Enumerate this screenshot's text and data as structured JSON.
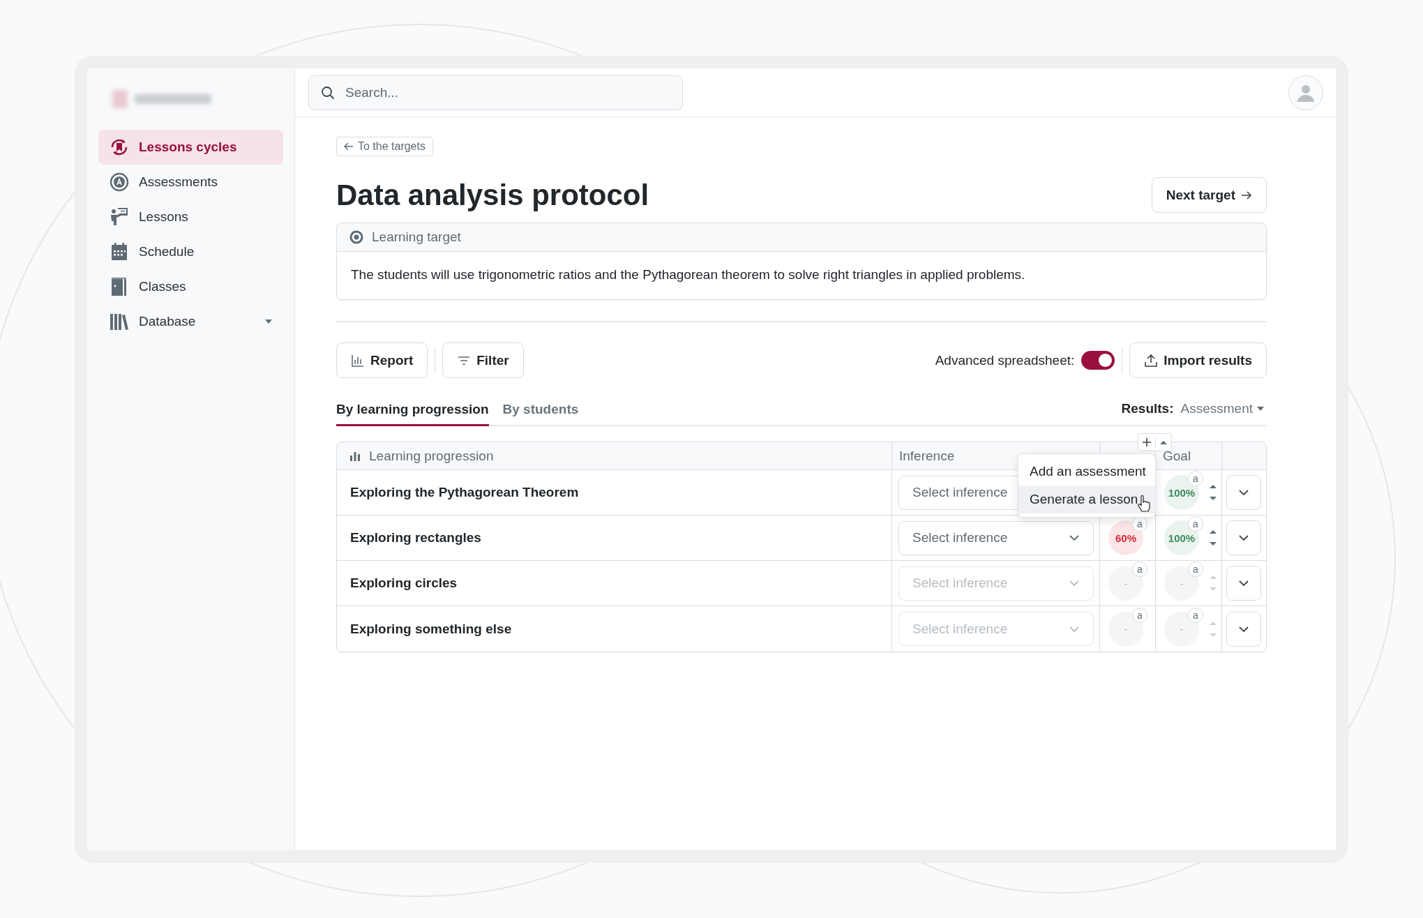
{
  "sidebar": {
    "items": [
      {
        "label": "Lessons cycles",
        "selected": true,
        "expandable": false
      },
      {
        "label": "Assessments",
        "selected": false,
        "expandable": false
      },
      {
        "label": "Lessons",
        "selected": false,
        "expandable": false
      },
      {
        "label": "Schedule",
        "selected": false,
        "expandable": false
      },
      {
        "label": "Classes",
        "selected": false,
        "expandable": false
      },
      {
        "label": "Database",
        "selected": false,
        "expandable": true
      }
    ]
  },
  "search": {
    "placeholder": "Search..."
  },
  "back_link": "To the targets",
  "page_title": "Data analysis protocol",
  "next_button": "Next target",
  "learning_target": {
    "heading": "Learning target",
    "text": "The students will use trigonometric ratios and the Pythagorean theorem to solve right triangles in applied problems."
  },
  "toolbar": {
    "buttons": [
      {
        "label": "Report"
      },
      {
        "label": "Filter"
      }
    ],
    "toggle": {
      "label": "Advanced spreadsheet:",
      "on": true
    },
    "import_button": "Import results"
  },
  "tabs": [
    {
      "label": "By learning progression",
      "selected": true
    },
    {
      "label": "By students",
      "selected": false
    }
  ],
  "results": {
    "label": "Results:",
    "value": "Assessment"
  },
  "table": {
    "columns": [
      {
        "label": "Learning progression"
      },
      {
        "label": "Inference"
      },
      {
        "label": "Goal"
      }
    ],
    "rows": [
      {
        "name": "Exploring the Pythagorean Theorem",
        "inference": "Select inference",
        "disabled": false,
        "score": null,
        "goal": {
          "value": "100%",
          "kind": "pass",
          "badge": "a"
        }
      },
      {
        "name": "Exploring rectangles",
        "inference": "Select inference",
        "disabled": false,
        "score": {
          "value": "60%",
          "kind": "fail",
          "badge": "a"
        },
        "goal": {
          "value": "100%",
          "kind": "pass",
          "badge": "a"
        }
      },
      {
        "name": "Exploring circles",
        "inference": "Select inference",
        "disabled": true,
        "score": {
          "value": "-",
          "kind": "empty",
          "badge": "a"
        },
        "goal": {
          "value": "-",
          "kind": "empty",
          "badge": "a"
        }
      },
      {
        "name": "Exploring something else",
        "inference": "Select inference",
        "disabled": true,
        "score": {
          "value": "-",
          "kind": "empty",
          "badge": "a"
        },
        "goal": {
          "value": "-",
          "kind": "empty",
          "badge": "a"
        }
      }
    ]
  },
  "menu": {
    "items": [
      {
        "label": "Add an assessment",
        "selected": false
      },
      {
        "label": "Generate a lesson",
        "selected": true
      }
    ]
  }
}
